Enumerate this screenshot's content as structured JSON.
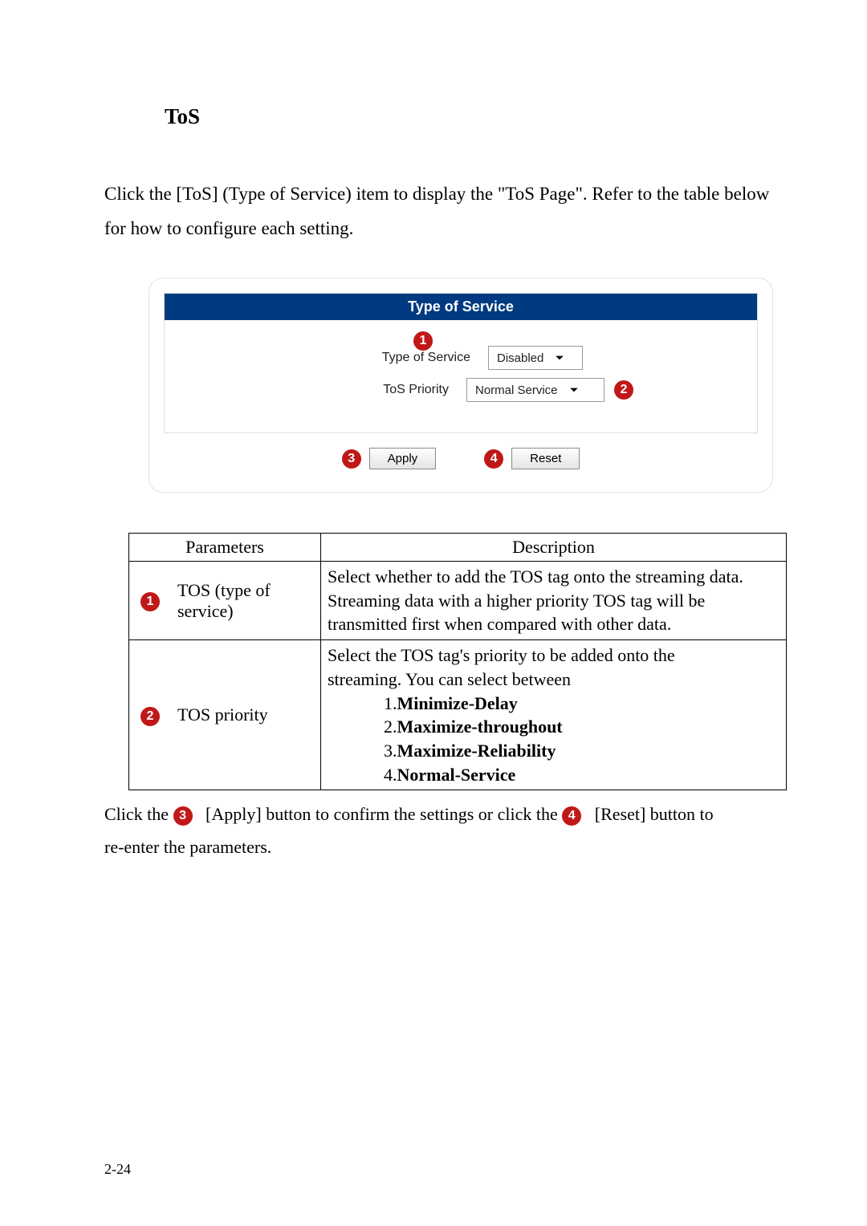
{
  "heading": "ToS",
  "intro": "Click the [ToS] (Type of Service) item to display the \"ToS Page\". Refer to the table below for how to configure each setting.",
  "panel": {
    "title": "Type of Service",
    "row1_label": "Type of Service",
    "row1_value": "Disabled",
    "row2_label": "ToS Priority",
    "row2_value": "Normal Service",
    "apply": "Apply",
    "reset": "Reset"
  },
  "badges": {
    "b1": "1",
    "b2": "2",
    "b3": "3",
    "b4": "4"
  },
  "table": {
    "h_param": "Parameters",
    "h_desc": "Description",
    "r1_param": "TOS (type of service)",
    "r1_desc": "Select whether to add the TOS tag onto the streaming data. Streaming data with a higher priority TOS tag will be transmitted first when compared with other data.",
    "r2_param": "TOS priority",
    "r2_desc_l1": "Select the TOS tag's priority to be added onto the",
    "r2_desc_l2": "streaming. You can select between",
    "r2_opt1_n": "1.",
    "r2_opt1": "Minimize-Delay",
    "r2_opt2_n": "2.",
    "r2_opt2": "Maximize-throughout",
    "r2_opt3_n": "3.",
    "r2_opt3": "Maximize-Reliability",
    "r2_opt4_n": "4.",
    "r2_opt4": "Normal-Service"
  },
  "footer": {
    "p1a": "Click the ",
    "p1b": " [Apply] button to confirm the settings or click the ",
    "p1c": " [Reset] button to",
    "p2": "re-enter the parameters."
  },
  "page_number": "2-24"
}
